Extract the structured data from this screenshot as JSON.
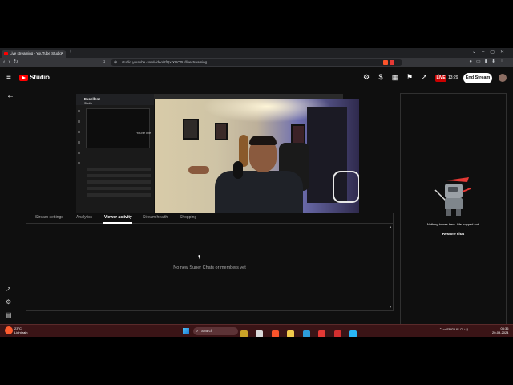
{
  "browser": {
    "tab_title": "Live streaming - YouTube Studio",
    "url": "studio.youtube.com/video/zfQx-XUO0U/livestreaming"
  },
  "header": {
    "brand": "Studio",
    "live_badge": "LIVE",
    "timer": "13:29",
    "end_stream_label": "End Stream"
  },
  "preview": {
    "title": "Excellent",
    "subtitle": "Studio",
    "youre_live": "You're live!"
  },
  "tabs": [
    {
      "label": "Stream settings"
    },
    {
      "label": "Analytics"
    },
    {
      "label": "Viewer activity"
    },
    {
      "label": "Stream health"
    },
    {
      "label": "Shopping"
    }
  ],
  "viewer_activity": {
    "empty_message": "No new Super Chats or members yet"
  },
  "chat": {
    "empty_message": "Nothing to see here. We popped out.",
    "restore_label": "Restore chat"
  },
  "taskbar": {
    "weather_temp": "23°C",
    "weather_desc": "Light rain",
    "search_label": "Search",
    "lang_1": "ENG",
    "lang_2": "US",
    "time": "03:36",
    "date": "20-09-2024"
  },
  "colors": {
    "accent": "#ff0000",
    "live": "#cc0000",
    "background": "#0f0f0f"
  }
}
